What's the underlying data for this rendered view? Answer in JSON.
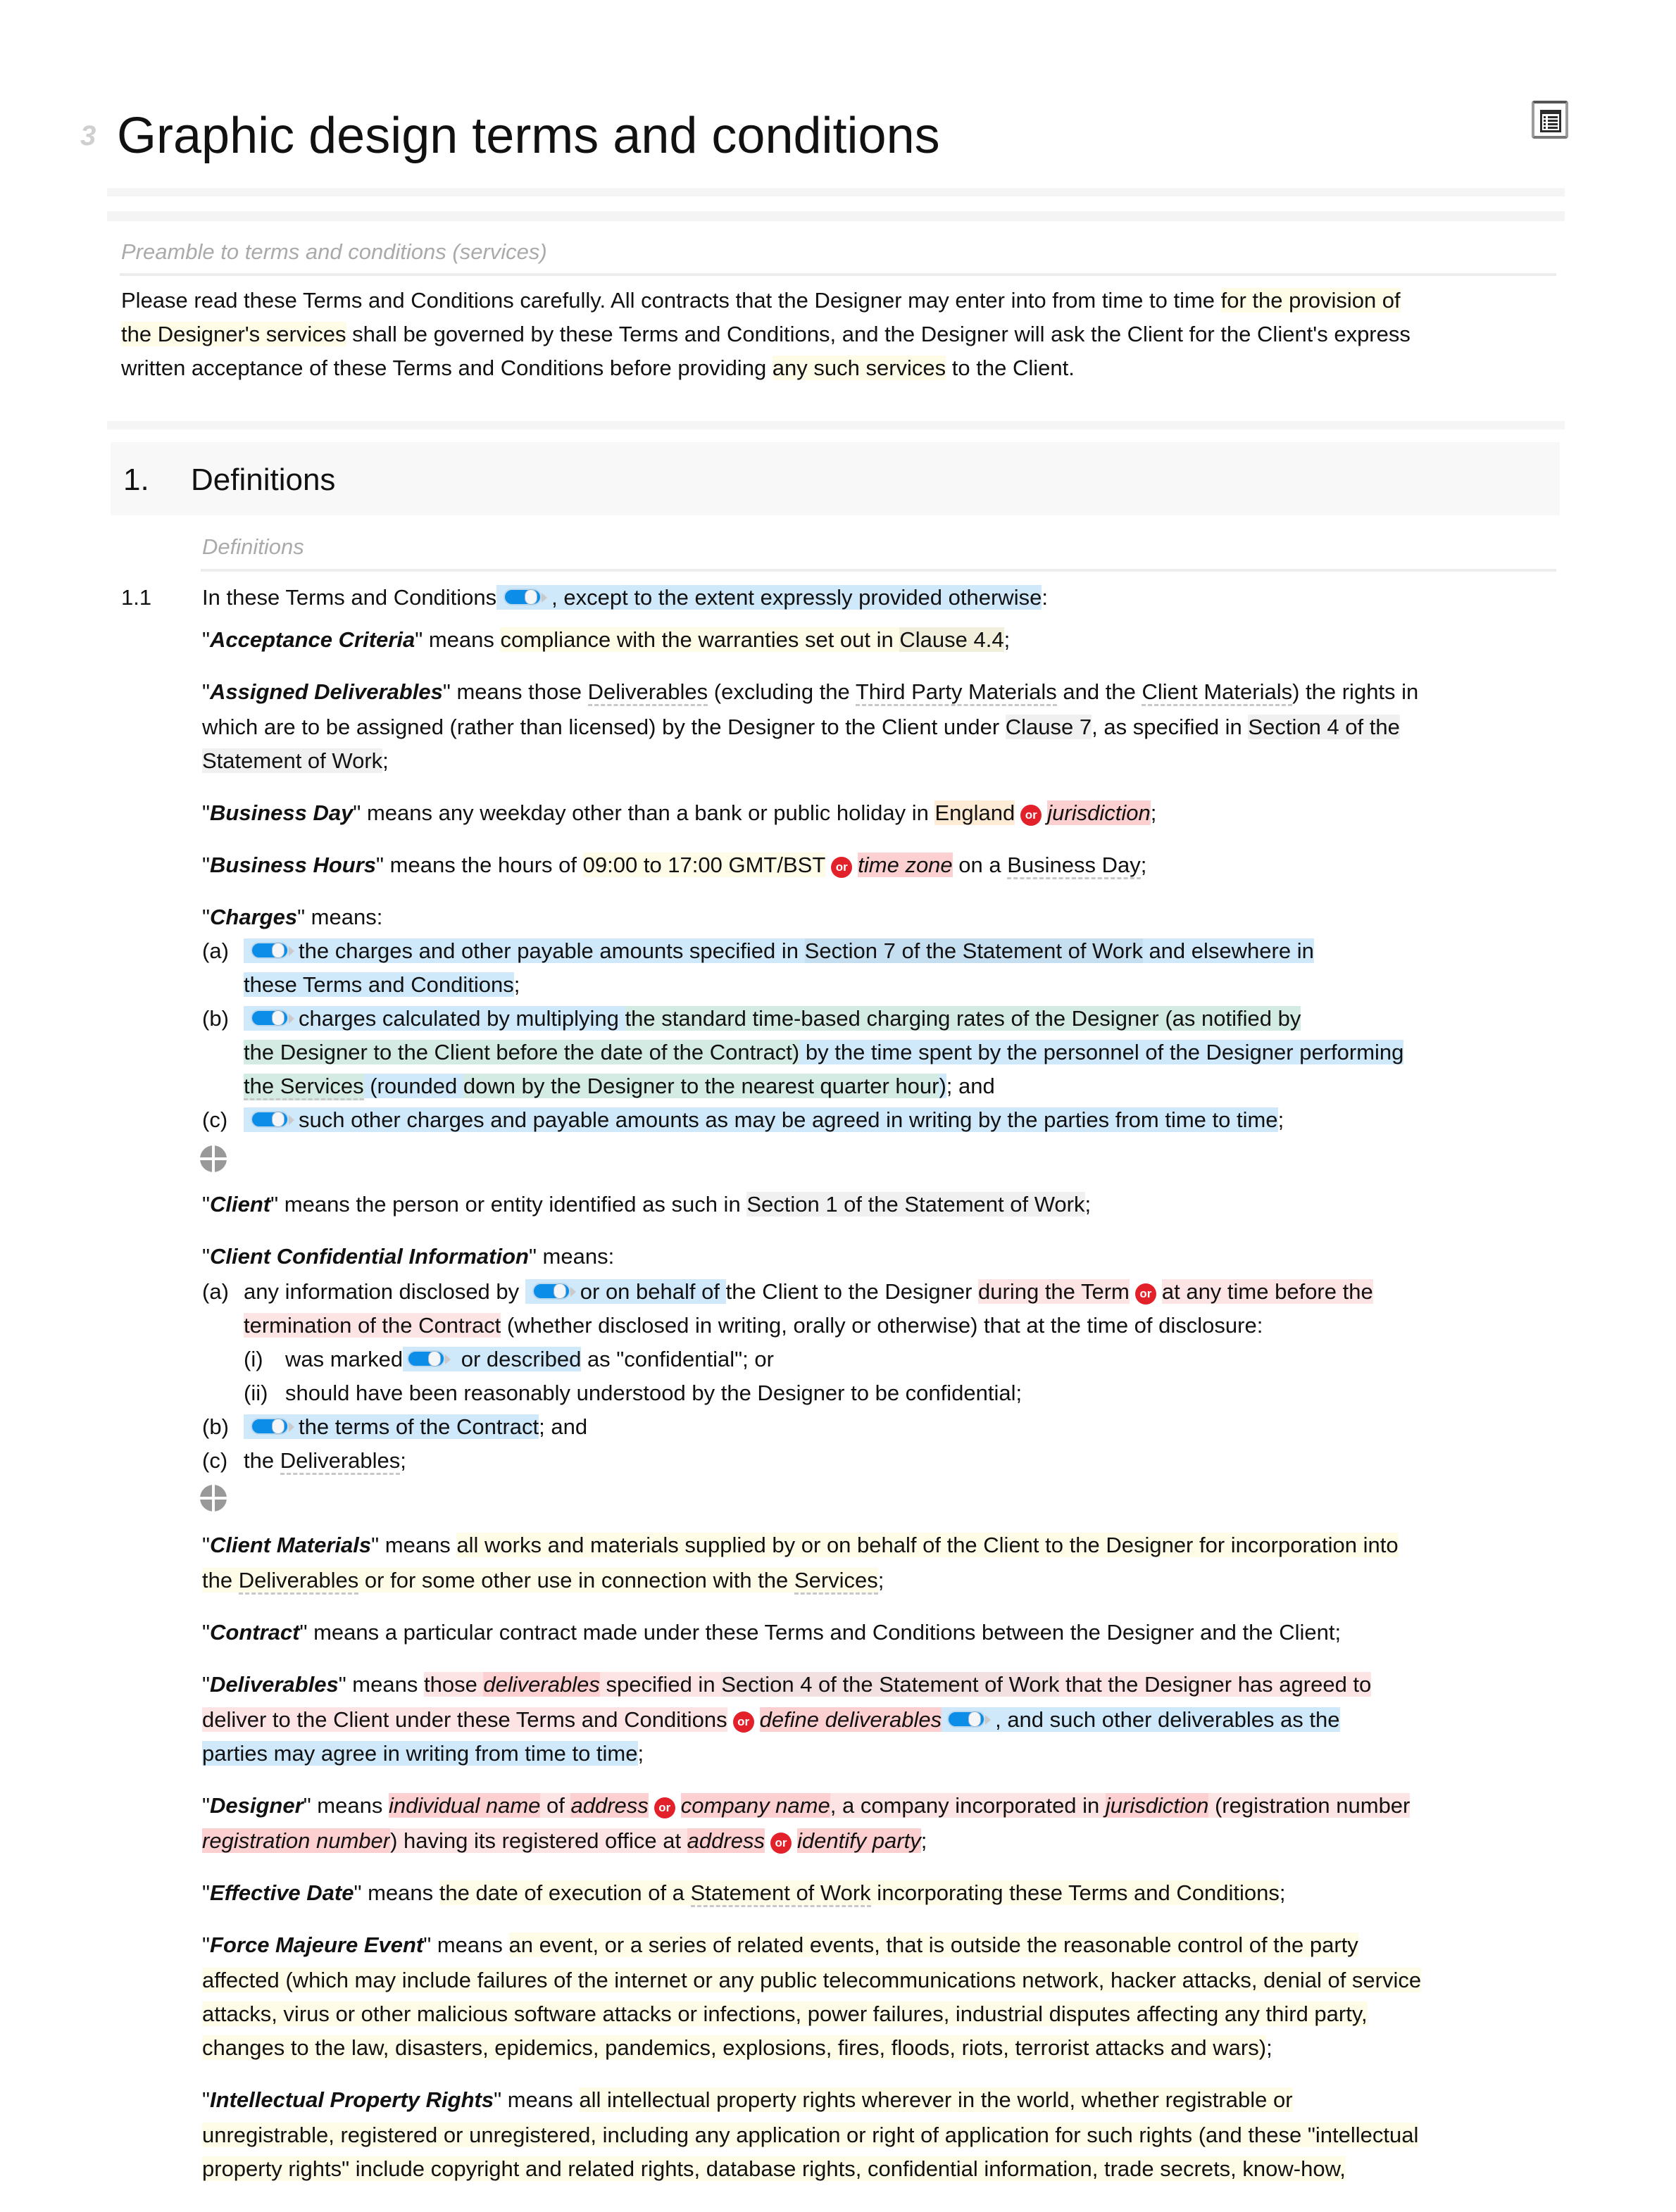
{
  "document": {
    "title_number_glyph": "3",
    "title": "Graphic design terms and conditions",
    "toc_button_icon": "table-of-contents-icon"
  },
  "preamble": {
    "heading": "Preamble to terms and conditions (services)",
    "lines": [
      {
        "a": "Please read these Terms and Conditions carefully. All contracts that the Designer may enter into from time to time ",
        "b": "for the provision of"
      },
      {
        "a": "the Designer's services",
        "b": " shall be governed by these Terms and Conditions, and the Designer will ask the Client for the Client's express"
      },
      {
        "a": "written acceptance of these Terms and Conditions before providing ",
        "b": "any such services",
        "c": " to the Client."
      }
    ]
  },
  "section1": {
    "number": "1.",
    "title": "Definitions",
    "subheading": "Definitions",
    "clause_number": "1.1",
    "intro": {
      "a": "In these Terms and Conditions",
      "b": ", except to the extent expressly provided otherwise",
      "c": ":"
    },
    "acceptance": {
      "q1": "\"",
      "term": "Acceptance Criteria",
      "q2": "\" means ",
      "a": "compliance with the warranties set out in ",
      "b": "Clause 4.4",
      "c": ";"
    },
    "assigned": {
      "term": "Assigned Deliverables",
      "l1a": "\" means those ",
      "l1b": "Deliverables",
      "l1c": " (excluding the ",
      "l1d": "Third Party Materials",
      "l1e": " and the ",
      "l1f": "Client Materials",
      "l1g": ") the rights in",
      "l2a": "which are to be assigned (rather than licensed) by the Designer to the Client under ",
      "l2b": "Clause 7",
      "l2c": ", as specified in ",
      "l2d": "Section 4 of the",
      "l3a": "Statement of Work",
      "l3b": ";"
    },
    "business_day": {
      "term": "Business Day",
      "a": "\" means any weekday other than a bank or public holiday in ",
      "b": "England",
      "or": "or",
      "c": "jurisdiction",
      "d": ";"
    },
    "business_hours": {
      "term": "Business Hours",
      "a": "\" means the hours of ",
      "b": "09:00 to 17:00 GMT/BST",
      "or": "or",
      "c": "time zone",
      "d": " on a ",
      "e": "Business Day",
      "f": ";"
    },
    "charges": {
      "term": "Charges",
      "means": "\" means:",
      "a_label": "(a)",
      "a1": "the charges and other payable amounts specified in ",
      "a2": "Section 7 of the Statement of Work",
      "a3": " and elsewhere in",
      "a4": "these Terms and Conditions",
      "a5": ";",
      "b_label": "(b)",
      "b1": "charges calculated by multiplying ",
      "b2": "the standard time-based charging rates of the Designer (as notified by",
      "b3": "the Designer to the Client before the date of the Contract)",
      "b4": " by the time spent by the personnel of the Designer performing",
      "b5": "the Services",
      "b6": " (rounded ",
      "b7": "down by the Designer to the nearest quarter hour",
      "b8": ")",
      "b9": "; and",
      "c_label": "(c)",
      "c1": "such other charges and payable amounts as may be agreed in writing by the parties from time to time",
      "c2": ";"
    },
    "client": {
      "term": "Client",
      "a": "\" means the person or entity identified as such in ",
      "b": "Section 1 of the Statement of Work",
      "c": ";"
    },
    "cci": {
      "term": "Client Confidential Information",
      "means": "\" means:",
      "a_label": "(a)",
      "a1": "any information disclosed by ",
      "a2": "or on behalf of ",
      "a3": "the Client to the Designer ",
      "a4": "during the Term",
      "or": "or",
      "a5": "at any time before the",
      "a6": "termination of the Contract",
      "a7": " (whether disclosed in writing, orally or otherwise) that at the time of disclosure:",
      "i_label": "(i)",
      "i1": "was marked",
      "i2": " or described",
      "i3": " as \"confidential\"; or",
      "ii_label": "(ii)",
      "ii1": "should have been reasonably understood by the Designer to be confidential;",
      "b_label": "(b)",
      "b1": "the terms of the Contract",
      "b2": "; and",
      "c_label": "(c)",
      "c1": "the ",
      "c2": "Deliverables",
      "c3": ";"
    },
    "client_materials": {
      "term": "Client Materials",
      "a": "\" means ",
      "b": "all works and materials supplied by or on behalf of the Client to the Designer for incorporation into",
      "c": "the ",
      "d": "Deliverables",
      "e": " or for some other use in connection with the ",
      "f": "Services",
      "g": ";"
    },
    "contract": {
      "term": "Contract",
      "a": "\" means a particular contract made under these Terms and Conditions between the Designer and the Client;"
    },
    "deliverables": {
      "term": "Deliverables",
      "a": "\" means ",
      "b": "those ",
      "c": "deliverables",
      "d": " specified in ",
      "e": "Section 4 of the Statement of Work",
      "f": " that the Designer has agreed to",
      "g": "deliver to the Client under these Terms and Conditions",
      "or": "or",
      "h": "define deliverables",
      "i": ", and such other deliverables as the",
      "j": "parties may agree in writing from time to time",
      "k": ";"
    },
    "designer": {
      "term": "Designer",
      "a": "\" means ",
      "b": "individual name",
      "c": " of ",
      "d": "address",
      "or": "or",
      "e": "company name",
      "f": ", a company incorporated in ",
      "g": "jurisdiction",
      "h": " (registration number",
      "i": "registration number",
      "j": ") having its registered office at ",
      "k": "address",
      "l": "identify party",
      "m": ";"
    },
    "effective_date": {
      "term": "Effective Date",
      "a": "\" means ",
      "b": "the date of execution of a ",
      "c": "Statement of Work",
      "d": " incorporating these Terms and Conditions",
      "e": ";"
    },
    "force_majeure": {
      "term": "Force Majeure Event",
      "a": "\" means ",
      "l1": "an event, or a series of related events, that is outside the reasonable control of the party",
      "l2": "affected (which may include failures of the internet or any public telecommunications network, hacker attacks, denial of service",
      "l3": "attacks, virus or other malicious software attacks or infections, power failures, industrial disputes affecting any third party,",
      "l4": "changes to the law, disasters, epidemics, pandemics, explosions, fires, floods, riots, terrorist attacks and wars)",
      "l5": ";"
    },
    "ipr": {
      "term": "Intellectual Property Rights",
      "a": "\" means ",
      "l1": "all intellectual property rights wherever in the world, whether registrable or",
      "l2": "unregistrable, registered or unregistered, including any application or right of application for such rights (and these \"intellectual",
      "l3": "property rights\" include copyright and related rights, database rights, confidential information, trade secrets, know-how,"
    },
    "quote_open": "\""
  }
}
